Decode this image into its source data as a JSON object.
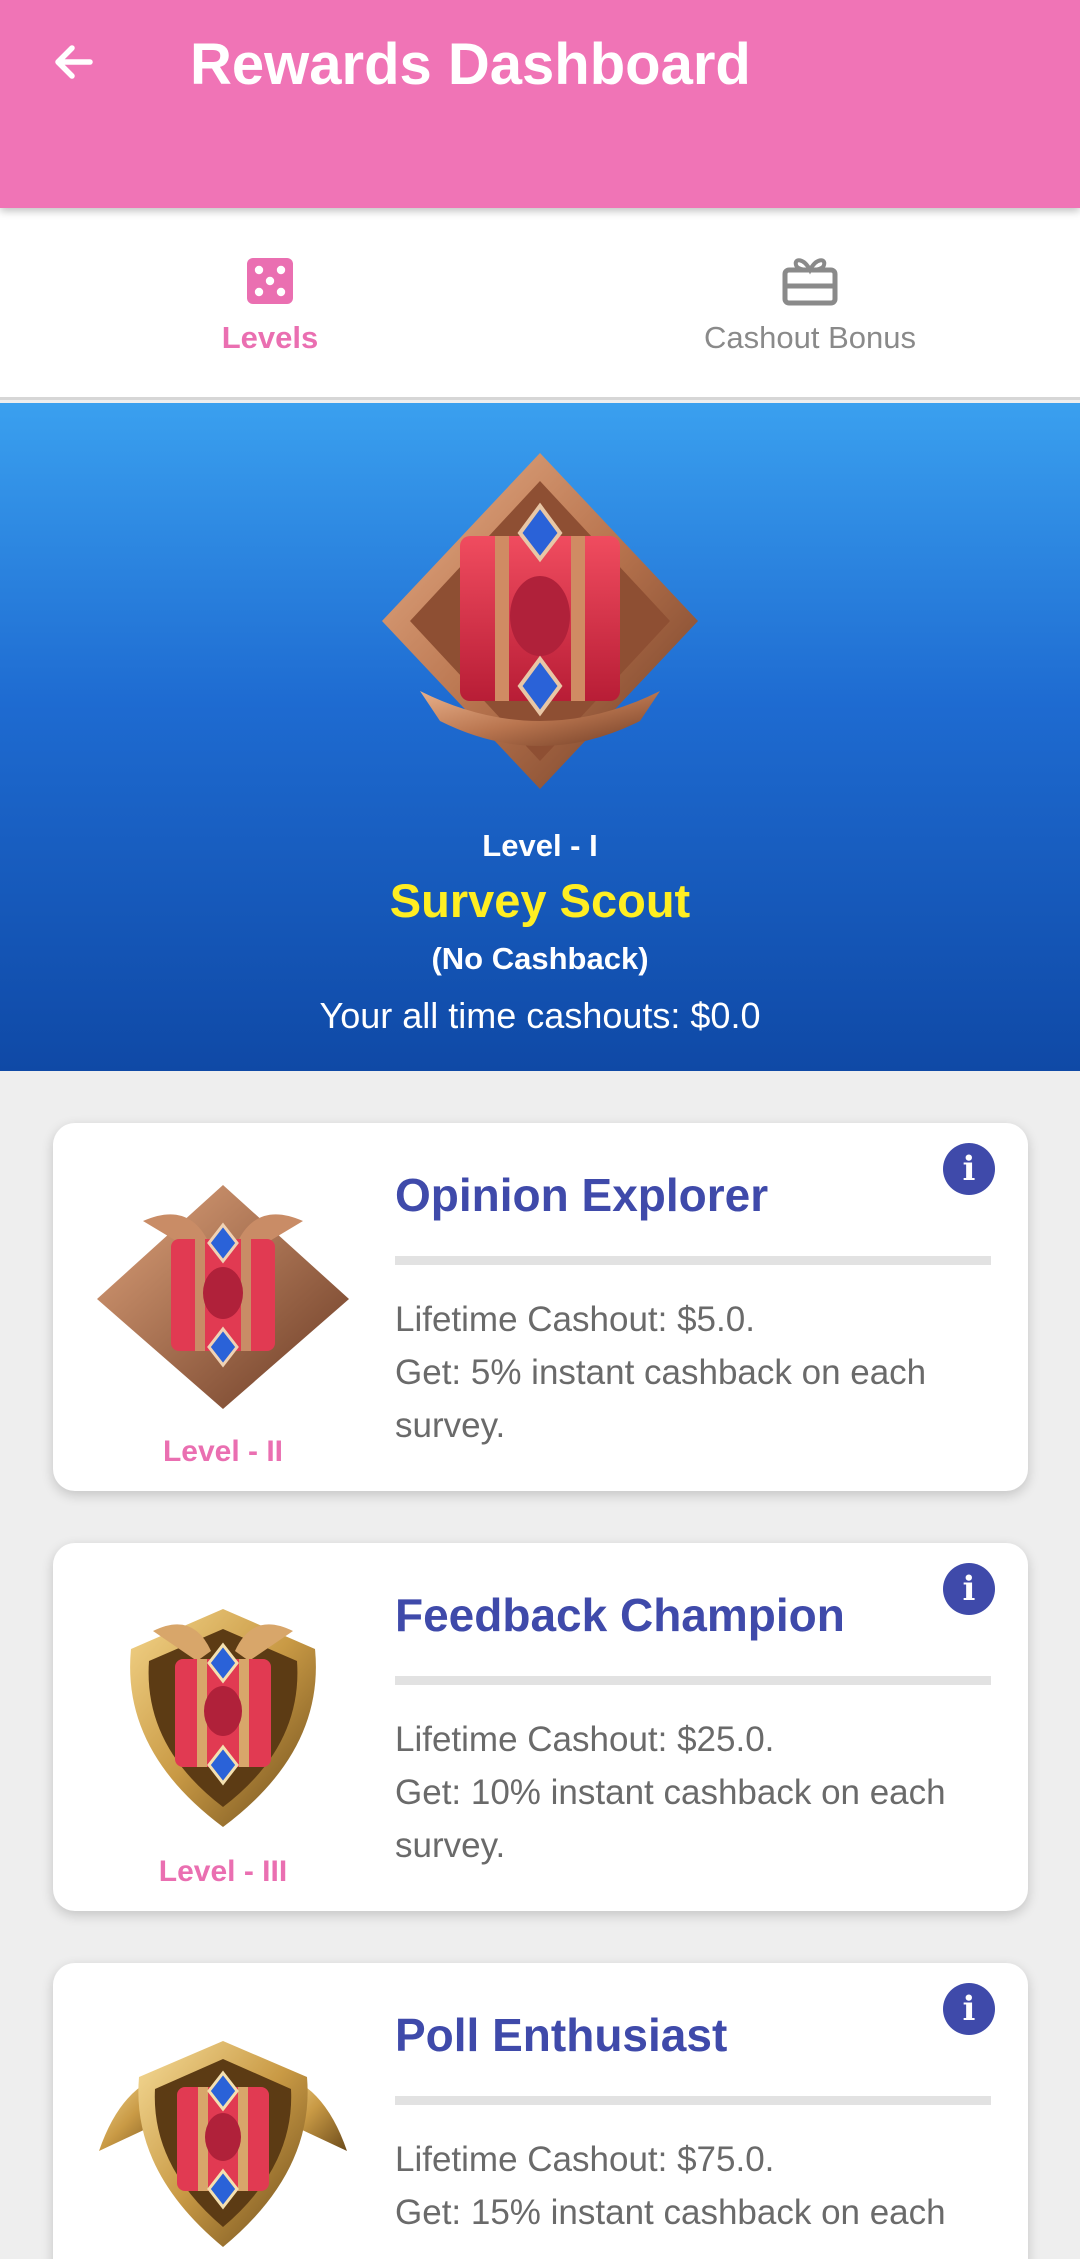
{
  "appbar": {
    "title": "Rewards Dashboard",
    "back_icon": "arrow-left-icon",
    "color": "#f074b6"
  },
  "tabs": [
    {
      "label": "Levels",
      "icon": "dice-icon",
      "active": true
    },
    {
      "label": "Cashout Bonus",
      "icon": "gift-card-icon",
      "active": false
    }
  ],
  "current_level": {
    "level": "Level - I",
    "name": "Survey Scout",
    "cashback": "(No Cashback)",
    "cashouts": "Your all time cashouts: $0.0",
    "badge_icon": "bronze-rank-badge-icon"
  },
  "levels": [
    {
      "level": "Level - II",
      "title": "Opinion Explorer",
      "line1": "Lifetime Cashout: $5.0.",
      "line2": "Get: 5% instant cashback on each survey.",
      "badge_icon": "bronze-winged-badge-icon"
    },
    {
      "level": "Level - III",
      "title": "Feedback Champion",
      "line1": "Lifetime Cashout: $25.0.",
      "line2": "Get: 10% instant cashback on each survey.",
      "badge_icon": "gold-shield-badge-icon"
    },
    {
      "level": "",
      "title": "Poll Enthusiast",
      "line1": "Lifetime Cashout: $75.0.",
      "line2": "Get: 15% instant cashback on each",
      "badge_icon": "gold-winged-badge-icon"
    }
  ],
  "colors": {
    "accent_pink": "#ea6fb1",
    "title_indigo": "#3f4aaa",
    "level_yellow": "#ffee22"
  }
}
